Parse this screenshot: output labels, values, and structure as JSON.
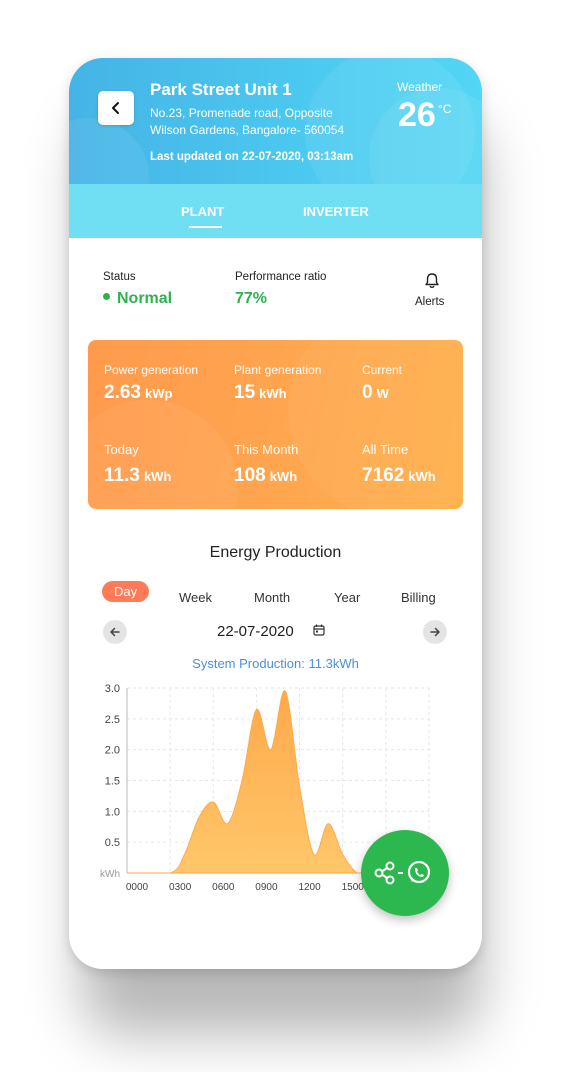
{
  "header": {
    "site_name": "Park Street Unit 1",
    "address_line1": "No.23, Promenade road, Opposite",
    "address_line2": "Wilson Gardens, Bangalore- 560054",
    "last_updated": "Last updated on 22-07-2020, 03:13am",
    "weather_label": "Weather",
    "temperature": "26",
    "temperature_unit": "°C"
  },
  "tabs": [
    {
      "label": "PLANT",
      "active": true
    },
    {
      "label": "INVERTER",
      "active": false
    }
  ],
  "status": {
    "label": "Status",
    "value": "Normal",
    "performance_label": "Performance ratio",
    "performance_value": "77%",
    "alerts_label": "Alerts"
  },
  "stats": [
    {
      "label": "Power generation",
      "value": "2.63",
      "unit": "kWp"
    },
    {
      "label": "Plant generation",
      "value": "15",
      "unit": "kWh"
    },
    {
      "label": "Current",
      "value": "0",
      "unit": "W"
    },
    {
      "label": "Today",
      "value": "11.3",
      "unit": "kWh"
    },
    {
      "label": "This Month",
      "value": "108",
      "unit": "kWh"
    },
    {
      "label": "All Time",
      "value": "7162",
      "unit": "kWh"
    }
  ],
  "energy": {
    "title": "Energy Production",
    "periods": [
      "Day",
      "Week",
      "Month",
      "Year",
      "Billing"
    ],
    "active_period": "Day",
    "date": "22-07-2020",
    "system_production": "System Production: 11.3kWh"
  },
  "colors": {
    "header_start": "#45b3e6",
    "tab_bar": "#70dff3",
    "status_green": "#2eb24d",
    "card_orange": "#ffa64e",
    "active_pill": "#ff7a57",
    "chart_fill": "#ffb347",
    "fab_green": "#2db84f"
  },
  "chart_data": {
    "type": "area",
    "ylabel": "kWh",
    "ylim": [
      0,
      3.0
    ],
    "yticks": [
      "3.0",
      "2.5",
      "2.0",
      "1.5",
      "1.0",
      "0.5"
    ],
    "xticks": [
      "0000",
      "0300",
      "0600",
      "0900",
      "1200",
      "1500"
    ],
    "x": [
      0,
      3,
      4,
      5,
      6,
      7,
      8,
      9,
      10,
      11,
      12,
      13,
      14,
      15,
      16,
      17
    ],
    "values": [
      0,
      0,
      0.3,
      0.9,
      1.15,
      0.8,
      1.5,
      2.65,
      2.0,
      2.95,
      1.4,
      0.3,
      0.8,
      0.3,
      0,
      0
    ],
    "grid": true
  },
  "fab": {
    "icon": "share-whatsapp-icon"
  }
}
